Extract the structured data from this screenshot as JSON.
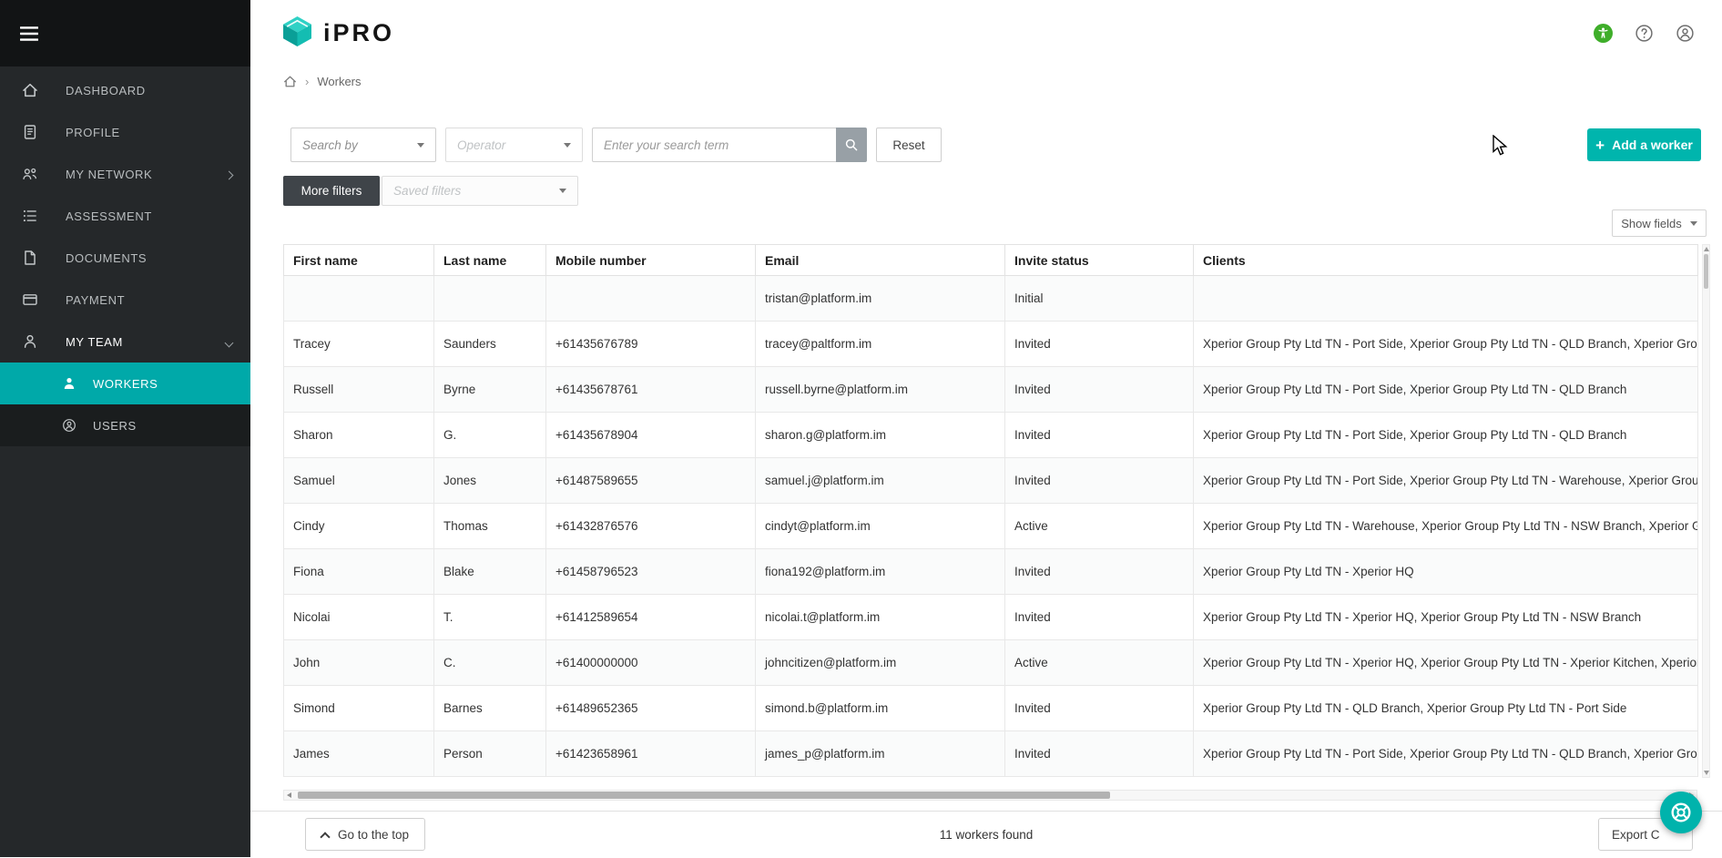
{
  "brand": {
    "name": "iPRO",
    "accent": "#00b5ad",
    "sidebar_active": "#00a9a9"
  },
  "sidebar": {
    "items": [
      {
        "id": "dashboard",
        "label": "DASHBOARD",
        "icon": "home"
      },
      {
        "id": "profile",
        "label": "PROFILE",
        "icon": "profile"
      },
      {
        "id": "my-network",
        "label": "MY NETWORK",
        "icon": "network",
        "chevron": "right"
      },
      {
        "id": "assessment",
        "label": "ASSESSMENT",
        "icon": "assessment"
      },
      {
        "id": "documents",
        "label": "DOCUMENTS",
        "icon": "documents"
      },
      {
        "id": "payment",
        "label": "PAYMENT",
        "icon": "payment"
      },
      {
        "id": "my-team",
        "label": "MY TEAM",
        "icon": "team",
        "chevron": "down",
        "expanded": true
      }
    ],
    "subitems": [
      {
        "id": "workers",
        "label": "WORKERS",
        "icon": "worker",
        "active": true
      },
      {
        "id": "users",
        "label": "USERS",
        "icon": "user",
        "active": false
      }
    ]
  },
  "breadcrumb": {
    "current": "Workers"
  },
  "toolbar": {
    "search_by": "Search by",
    "operator": "Operator",
    "search_placeholder": "Enter your search term",
    "reset": "Reset",
    "more_filters": "More filters",
    "saved_filters": "Saved filters",
    "add_worker": "Add a worker",
    "show_fields": "Show fields"
  },
  "table": {
    "columns": [
      "First name",
      "Last name",
      "Mobile number",
      "Email",
      "Invite status",
      "Clients"
    ],
    "rows": [
      {
        "first": "",
        "last": "",
        "mobile": "",
        "email": "tristan@platform.im",
        "status": "Initial",
        "clients": ""
      },
      {
        "first": "Tracey",
        "last": "Saunders",
        "mobile": "+61435676789",
        "email": "tracey@paltform.im",
        "status": "Invited",
        "clients": "Xperior Group Pty Ltd TN - Port Side, Xperior Group Pty Ltd TN - QLD Branch, Xperior Group …"
      },
      {
        "first": "Russell",
        "last": "Byrne",
        "mobile": "+61435678761",
        "email": "russell.byrne@platform.im",
        "status": "Invited",
        "clients": "Xperior Group Pty Ltd TN - Port Side, Xperior Group Pty Ltd TN - QLD Branch"
      },
      {
        "first": "Sharon",
        "last": "G.",
        "mobile": "+61435678904",
        "email": "sharon.g@platform.im",
        "status": "Invited",
        "clients": "Xperior Group Pty Ltd TN - Port Side, Xperior Group Pty Ltd TN - QLD Branch"
      },
      {
        "first": "Samuel",
        "last": "Jones",
        "mobile": "+61487589655",
        "email": "samuel.j@platform.im",
        "status": "Invited",
        "clients": "Xperior Group Pty Ltd TN - Port Side, Xperior Group Pty Ltd TN - Warehouse, Xperior Group P…"
      },
      {
        "first": "Cindy",
        "last": "Thomas",
        "mobile": "+61432876576",
        "email": "cindyt@platform.im",
        "status": "Active",
        "clients": "Xperior Group Pty Ltd TN - Warehouse, Xperior Group Pty Ltd TN - NSW Branch, Xperior Grou…"
      },
      {
        "first": "Fiona",
        "last": "Blake",
        "mobile": "+61458796523",
        "email": "fiona192@platform.im",
        "status": "Invited",
        "clients": "Xperior Group Pty Ltd TN - Xperior HQ"
      },
      {
        "first": "Nicolai",
        "last": "T.",
        "mobile": "+61412589654",
        "email": "nicolai.t@platform.im",
        "status": "Invited",
        "clients": "Xperior Group Pty Ltd TN - Xperior HQ, Xperior Group Pty Ltd TN - NSW Branch"
      },
      {
        "first": "John",
        "last": "C.",
        "mobile": "+61400000000",
        "email": "johncitizen@platform.im",
        "status": "Active",
        "clients": "Xperior Group Pty Ltd TN - Xperior HQ, Xperior Group Pty Ltd TN - Xperior Kitchen, Xperior G…"
      },
      {
        "first": "Simond",
        "last": "Barnes",
        "mobile": "+61489652365",
        "email": "simond.b@platform.im",
        "status": "Invited",
        "clients": "Xperior Group Pty Ltd TN - QLD Branch, Xperior Group Pty Ltd TN - Port Side"
      },
      {
        "first": "James",
        "last": "Person",
        "mobile": "+61423658961",
        "email": "james_p@platform.im",
        "status": "Invited",
        "clients": "Xperior Group Pty Ltd TN - Port Side, Xperior Group Pty Ltd TN - QLD Branch, Xperior Group …"
      }
    ]
  },
  "footer": {
    "go_to_top": "Go to the top",
    "results_count": "11 workers found",
    "export": "Export C"
  }
}
